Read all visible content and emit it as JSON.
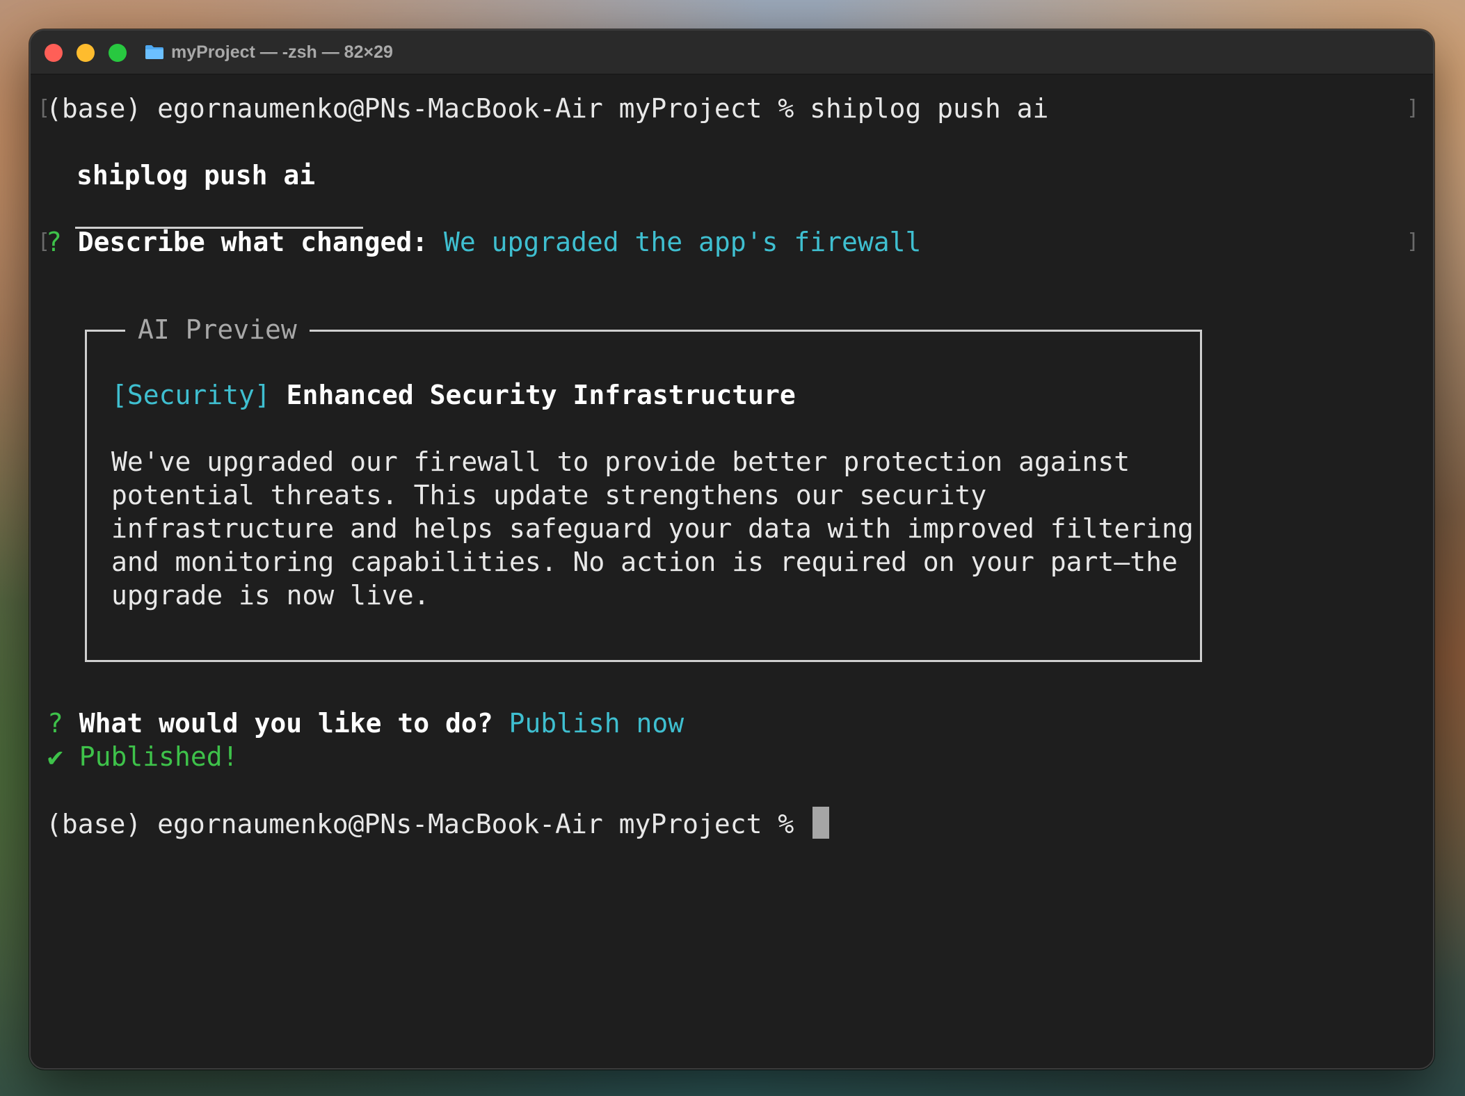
{
  "window": {
    "title": "myProject — -zsh — 82×29"
  },
  "terminal": {
    "prompt": "(base) egornaumenko@PNs-MacBook-Air myProject %",
    "command": "shiplog push ai",
    "header": "shiplog push ai",
    "describe": {
      "mark": "?",
      "question": "Describe what changed:",
      "answer": "We upgraded the app's firewall"
    },
    "preview": {
      "label": "AI Preview",
      "tag": "[Security]",
      "title": "Enhanced Security Infrastructure",
      "body": "We've upgraded our firewall to provide better protection against potential threats. This update strengthens our security infrastructure and helps safeguard your data with improved filtering and monitoring capabilities. No action is required on your part—the upgrade is now live."
    },
    "action": {
      "mark": "?",
      "question": "What would you like to do?",
      "answer": "Publish now"
    },
    "result": {
      "mark": "✔",
      "text": "Published!"
    },
    "final_prompt": "(base) egornaumenko@PNs-MacBook-Air myProject %"
  },
  "colors": {
    "accent_cyan": "#3fbfd0",
    "success_green": "#3ec24a",
    "background": "#1e1e1e"
  },
  "icons": {
    "title_folder": "folder-icon"
  }
}
